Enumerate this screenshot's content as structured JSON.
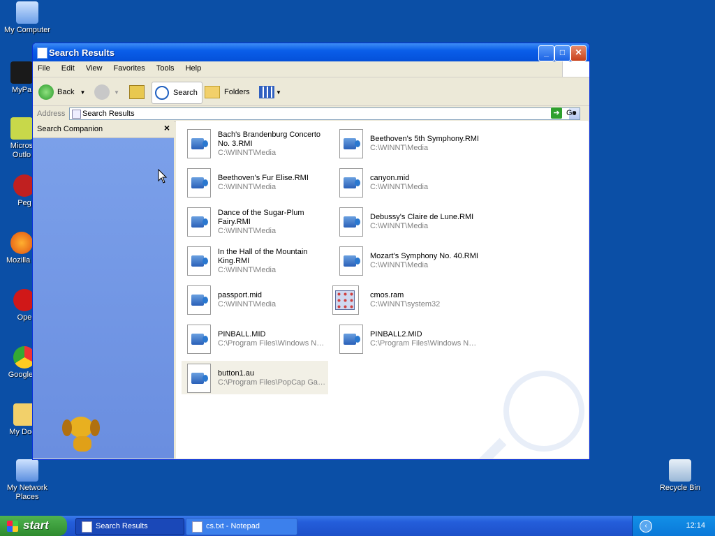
{
  "desktop": {
    "icons": [
      {
        "label": "My Computer"
      },
      {
        "label": "MyPa"
      },
      {
        "label": "Micros\nOutlo"
      },
      {
        "label": "Peg"
      },
      {
        "label": "Mozilla F"
      },
      {
        "label": "Ope"
      },
      {
        "label": "Google C"
      },
      {
        "label": "My Docu"
      },
      {
        "label": "My Network\nPlaces"
      },
      {
        "label": "Recycle Bin"
      }
    ]
  },
  "window": {
    "title": "Search Results",
    "menu": [
      "File",
      "Edit",
      "View",
      "Favorites",
      "Tools",
      "Help"
    ],
    "toolbar": {
      "back": "Back",
      "search": "Search",
      "folders": "Folders"
    },
    "address": {
      "label": "Address",
      "value": "Search Results",
      "go": "Go"
    },
    "sidebar": {
      "title": "Search Companion"
    },
    "files": [
      {
        "name": "Bach's Brandenburg Concerto No. 3.RMI",
        "path": "C:\\WINNT\\Media",
        "icon": "media-file-icon"
      },
      {
        "name": "Beethoven's 5th Symphony.RMI",
        "path": "C:\\WINNT\\Media",
        "icon": "media-file-icon"
      },
      {
        "name": "Beethoven's Fur Elise.RMI",
        "path": "C:\\WINNT\\Media",
        "icon": "media-file-icon"
      },
      {
        "name": "canyon.mid",
        "path": "C:\\WINNT\\Media",
        "icon": "media-file-icon"
      },
      {
        "name": "Dance of the Sugar-Plum Fairy.RMI",
        "path": "C:\\WINNT\\Media",
        "icon": "media-file-icon"
      },
      {
        "name": "Debussy's Claire de Lune.RMI",
        "path": "C:\\WINNT\\Media",
        "icon": "media-file-icon"
      },
      {
        "name": "In the Hall of the Mountain King.RMI",
        "path": "C:\\WINNT\\Media",
        "icon": "media-file-icon"
      },
      {
        "name": "Mozart's Symphony No. 40.RMI",
        "path": "C:\\WINNT\\Media",
        "icon": "media-file-icon"
      },
      {
        "name": "passport.mid",
        "path": "C:\\WINNT\\Media",
        "icon": "media-file-icon"
      },
      {
        "name": "cmos.ram",
        "path": "C:\\WINNT\\system32",
        "icon": "application-file-icon"
      },
      {
        "name": "PINBALL.MID",
        "path": "C:\\Program Files\\Windows NT\\...",
        "icon": "media-file-icon"
      },
      {
        "name": "PINBALL2.MID",
        "path": "C:\\Program Files\\Windows NT\\...",
        "icon": "media-file-icon"
      },
      {
        "name": "button1.au",
        "path": "C:\\Program Files\\PopCap Gam...",
        "icon": "media-file-icon"
      }
    ]
  },
  "taskbar": {
    "start": "start",
    "tasks": [
      {
        "label": "Search Results"
      },
      {
        "label": "cs.txt - Notepad"
      }
    ],
    "clock": "12:14"
  }
}
